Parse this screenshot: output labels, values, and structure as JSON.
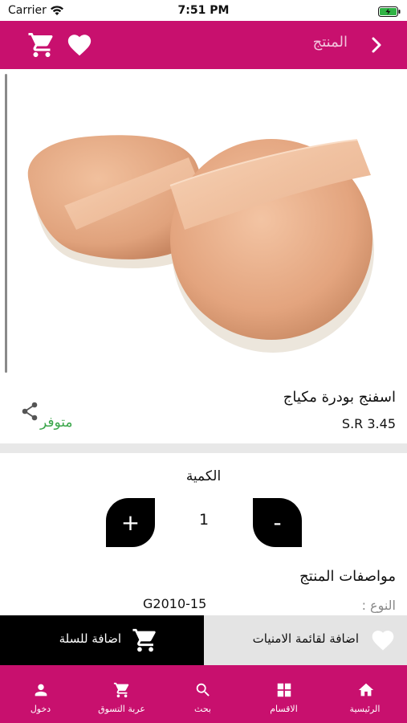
{
  "status_bar": {
    "carrier": "Carrier",
    "time": "7:51 PM"
  },
  "header": {
    "title": "المنتج",
    "background_color": "#c8106e",
    "icons": [
      "cart-icon",
      "heart-icon",
      "chevron-right-icon"
    ]
  },
  "product": {
    "image_description_icon": "powder-puff-image",
    "name": "اسفنج بودرة مكياج",
    "price": "S.R 3.45",
    "availability": "متوفر",
    "availability_color": "#3aa64a"
  },
  "quantity": {
    "label": "الكمية",
    "value": "1",
    "plus_label": "+",
    "minus_label": "-"
  },
  "specs": {
    "title": "مواصفات المنتج",
    "rows": [
      {
        "label": "النوع :",
        "value": "G2010-15"
      }
    ]
  },
  "actions": {
    "add_to_cart": "اضافة للسلة",
    "add_to_wishlist": "اضافة لقائمة الامنيات"
  },
  "tab_bar": {
    "items": [
      {
        "label": "دخول",
        "icon": "person-icon"
      },
      {
        "label": "عربة التسوق",
        "icon": "cart-icon"
      },
      {
        "label": "بحث",
        "icon": "search-icon"
      },
      {
        "label": "الاقسام",
        "icon": "grid-icon"
      },
      {
        "label": "الرئيسية",
        "icon": "home-icon"
      }
    ]
  }
}
